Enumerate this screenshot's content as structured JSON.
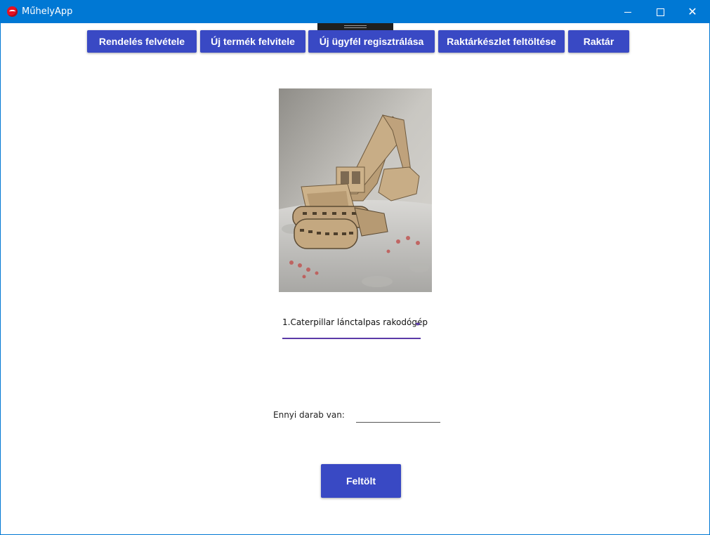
{
  "window": {
    "title": "MűhelyApp",
    "close_glyph": "✕"
  },
  "nav": {
    "items": [
      {
        "label": "Rendelés felvétele"
      },
      {
        "label": "Új termék felvitele"
      },
      {
        "label": "Új ügyfél regisztrálása"
      },
      {
        "label": "Raktárkészlet feltöltése"
      },
      {
        "label": "Raktár"
      }
    ]
  },
  "product": {
    "selected": "1.Caterpillar lánctalpas rakodógép",
    "image_icon": "wooden-excavator-photo"
  },
  "form": {
    "quantity_label": "Ennyi darab van:",
    "quantity_value": "",
    "submit_label": "Feltölt"
  },
  "colors": {
    "titlebar": "#0078d4",
    "button": "#3949c4",
    "accent": "#5b3aa8"
  }
}
